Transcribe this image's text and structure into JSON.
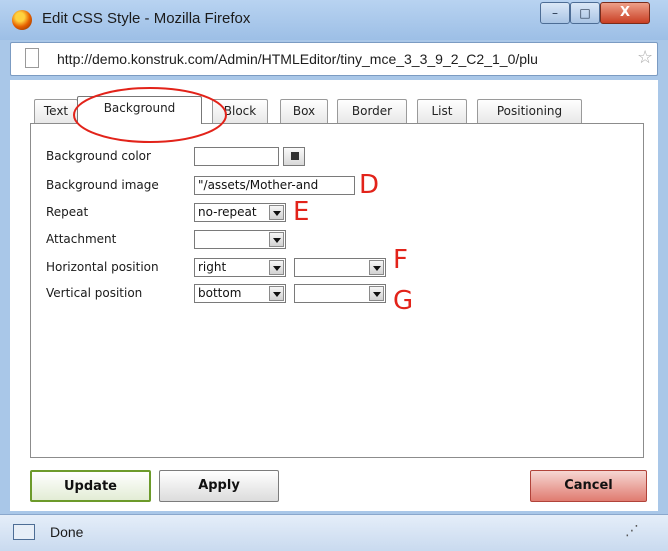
{
  "window": {
    "title": "Edit CSS Style - Mozilla Firefox",
    "url": "http://demo.konstruk.com/Admin/HTMLEditor/tiny_mce_3_3_9_2_C2_1_0/plu",
    "minimize_glyph": "–",
    "maximize_glyph": "□",
    "close_glyph": "X"
  },
  "tabs": [
    {
      "label": "Text"
    },
    {
      "label": "Background"
    },
    {
      "label": "Block"
    },
    {
      "label": "Box"
    },
    {
      "label": "Border"
    },
    {
      "label": "List"
    },
    {
      "label": "Positioning"
    }
  ],
  "active_tab": "Background",
  "form": {
    "background_color": {
      "label": "Background color",
      "value": ""
    },
    "background_image": {
      "label": "Background image",
      "value": "\"/assets/Mother-and"
    },
    "repeat": {
      "label": "Repeat",
      "value": "no-repeat"
    },
    "attachment": {
      "label": "Attachment",
      "value": ""
    },
    "horizontal_position": {
      "label": "Horizontal position",
      "value": "right",
      "unit": ""
    },
    "vertical_position": {
      "label": "Vertical position",
      "value": "bottom",
      "unit": ""
    }
  },
  "annotations": {
    "d": "D",
    "e": "E",
    "f": "F",
    "g": "G"
  },
  "buttons": {
    "update": "Update",
    "apply": "Apply",
    "cancel": "Cancel"
  },
  "status": {
    "text": "Done"
  },
  "colors": {
    "annotation_red": "#e2231a",
    "window_chrome": "#a9c7e8"
  }
}
